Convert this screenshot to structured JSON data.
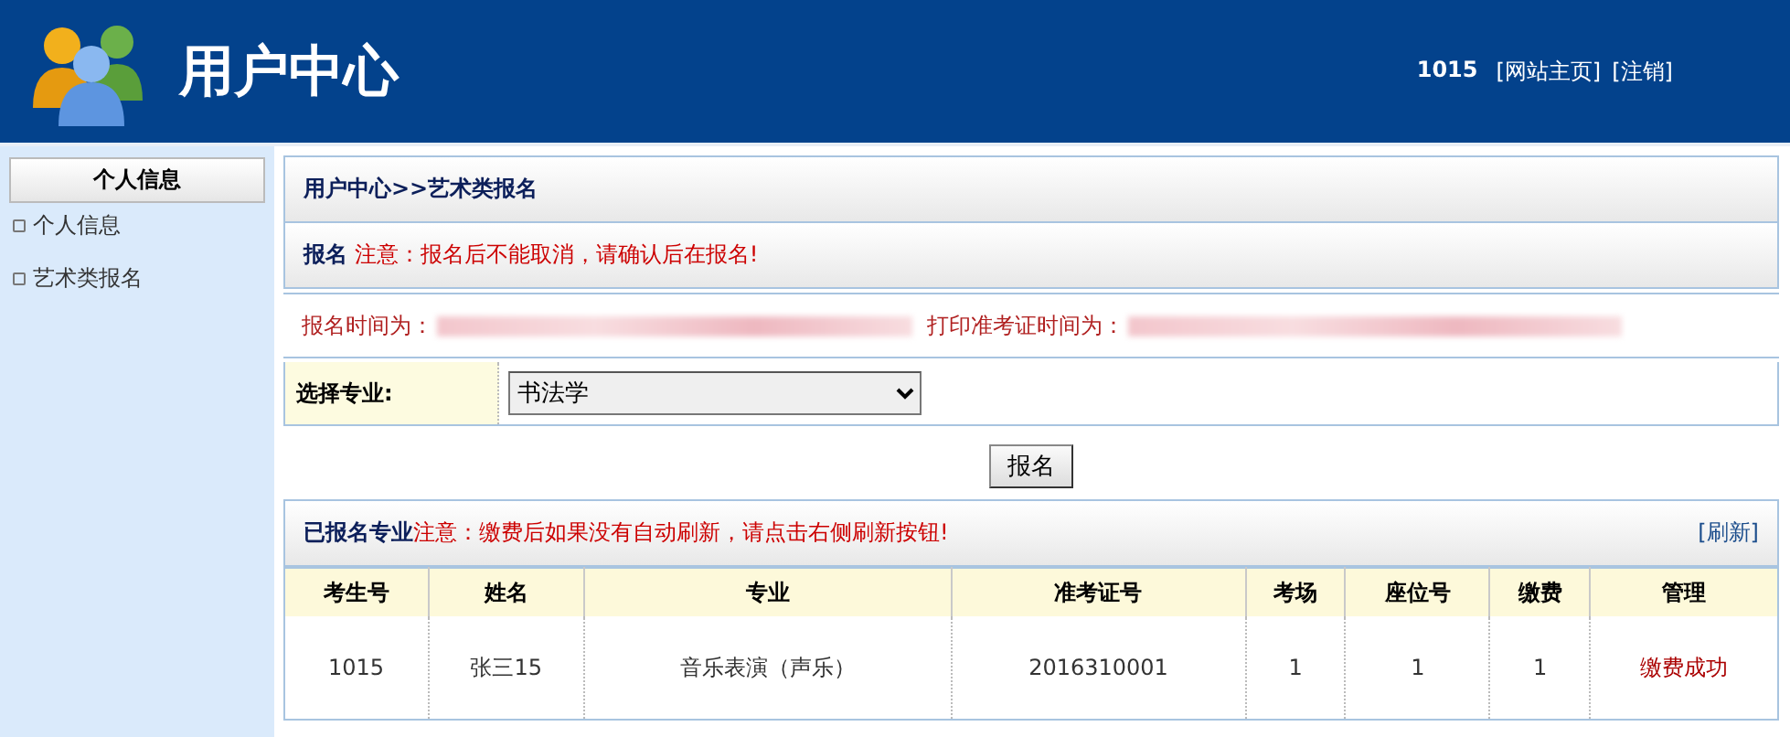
{
  "header": {
    "title": "用户中心",
    "user_id": "1015",
    "links": [
      "[网站主页]",
      "[注销]"
    ]
  },
  "sidebar": {
    "heading": "个人信息",
    "items": [
      {
        "label": "个人信息"
      },
      {
        "label": "艺术类报名"
      }
    ]
  },
  "breadcrumb": "用户中心>>艺术类报名",
  "notice": {
    "label": "报名",
    "text": "注意：报名后不能取消，请确认后在报名!"
  },
  "times": [
    {
      "label": "报名时间为："
    },
    {
      "label": "打印准考证时间为："
    }
  ],
  "major_field": {
    "label": "选择专业:",
    "value": "书法学"
  },
  "submit_button": "报名",
  "registered": {
    "label": "已报名专业",
    "text": "注意：缴费后如果没有自动刷新，请点击右侧刷新按钮!",
    "refresh_link": "[刷新]",
    "columns": [
      "考生号",
      "姓名",
      "专业",
      "准考证号",
      "考场",
      "座位号",
      "缴费",
      "管理"
    ],
    "rows": [
      [
        "1015",
        "张三15",
        "音乐表演（声乐）",
        "2016310001",
        "1",
        "1",
        "1",
        "缴费成功"
      ]
    ]
  }
}
